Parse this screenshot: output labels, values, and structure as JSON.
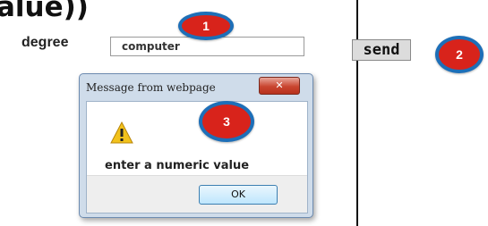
{
  "code_fragment": "alue))",
  "form": {
    "degree_label": "degree",
    "degree_value": "computer",
    "send_label": "send"
  },
  "badges": {
    "one": "1",
    "two": "2",
    "three": "3"
  },
  "dialog": {
    "title": "Message from webpage",
    "close_icon": "close-icon",
    "warning_icon": "warning-icon",
    "message": "enter a numeric value",
    "ok_label": "OK"
  },
  "colors": {
    "badge_fill": "#d8231b",
    "badge_ring": "#1d6fb8",
    "close_button": "#c9452f",
    "dialog_frame": "#cfdcea"
  }
}
